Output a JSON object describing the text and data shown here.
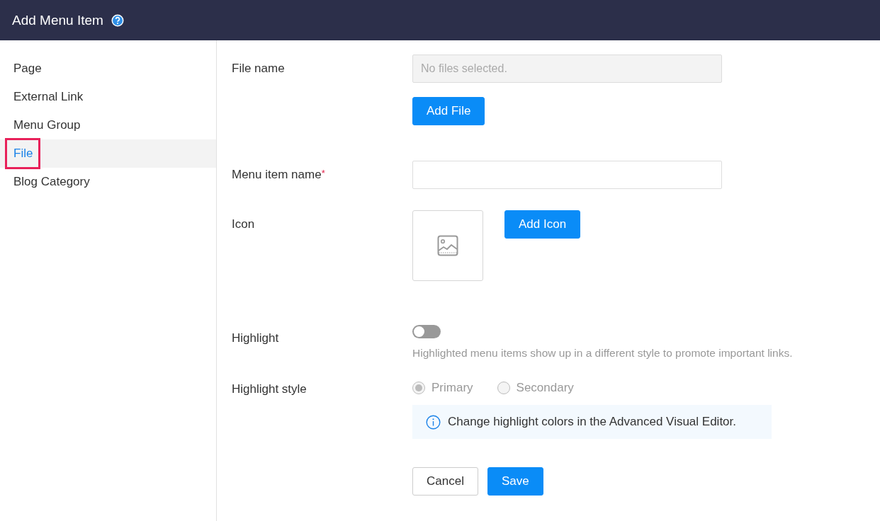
{
  "header": {
    "title": "Add Menu Item"
  },
  "sidebar": {
    "items": [
      {
        "label": "Page",
        "selected": false,
        "marked": false
      },
      {
        "label": "External Link",
        "selected": false,
        "marked": false
      },
      {
        "label": "Menu Group",
        "selected": false,
        "marked": false
      },
      {
        "label": "File",
        "selected": true,
        "marked": true
      },
      {
        "label": "Blog Category",
        "selected": false,
        "marked": false
      }
    ]
  },
  "form": {
    "file_name": {
      "label": "File name",
      "placeholder": "No files selected.",
      "button": "Add File"
    },
    "menu_item_name": {
      "label": "Menu item name",
      "required_mark": "*"
    },
    "icon": {
      "label": "Icon",
      "button": "Add Icon"
    },
    "highlight": {
      "label": "Highlight",
      "on": false,
      "help": "Highlighted menu items show up in a different style to promote important links."
    },
    "highlight_style": {
      "label": "Highlight style",
      "disabled": true,
      "options": [
        {
          "label": "Primary",
          "selected": true
        },
        {
          "label": "Secondary",
          "selected": false
        }
      ],
      "info": "Change highlight colors in the Advanced Visual Editor."
    },
    "buttons": [
      {
        "label": "Cancel",
        "kind": "secondary"
      },
      {
        "label": "Save",
        "kind": "primary"
      }
    ]
  }
}
